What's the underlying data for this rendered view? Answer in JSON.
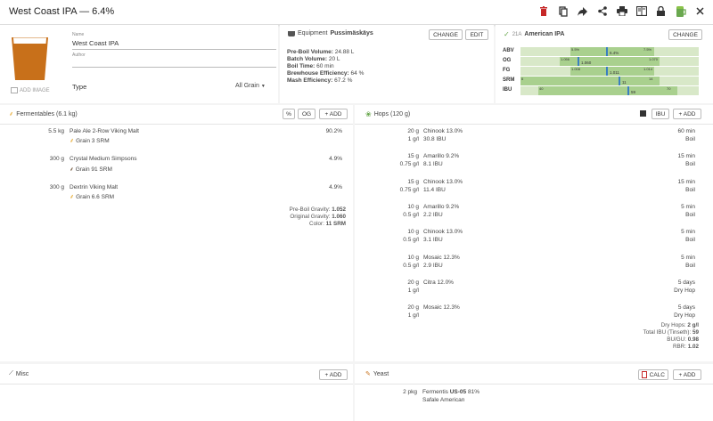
{
  "header": {
    "title": "West Coast IPA — 6.4%"
  },
  "toolbar_icons": [
    "delete-icon",
    "copy-icon",
    "share-arrow-icon",
    "share-icon",
    "print-icon",
    "book-icon",
    "lock-icon",
    "beer-icon",
    "close-icon"
  ],
  "recipe": {
    "add_image_label": "ADD IMAGE",
    "name_label": "Name",
    "name_value": "West Coast IPA",
    "author_label": "Author",
    "author_value": "",
    "type_label": "Type",
    "type_value": "All Grain"
  },
  "equipment": {
    "label": "Equipment",
    "name": "Pussimäskäys",
    "change_label": "CHANGE",
    "edit_label": "EDIT",
    "stats": [
      {
        "k": "Pre-Boil Volume:",
        "v": "24.88 L"
      },
      {
        "k": "Batch Volume:",
        "v": "20 L"
      },
      {
        "k": "Boil Time:",
        "v": "60 min"
      },
      {
        "k": "Brewhouse Efficiency:",
        "v": "64 %"
      },
      {
        "k": "Mash Efficiency:",
        "v": "67.2 %"
      }
    ]
  },
  "style": {
    "code": "21A",
    "name": "American IPA",
    "change_label": "CHANGE",
    "rows": [
      {
        "name": "ABV",
        "min": "5.5%",
        "max": "7.5%",
        "value": "6.4%",
        "range": [
          0.28,
          0.75
        ],
        "pos": 0.48
      },
      {
        "name": "OG",
        "min": "1.056",
        "max": "1.070",
        "value": "1.060",
        "range": [
          0.22,
          0.78
        ],
        "pos": 0.32
      },
      {
        "name": "FG",
        "min": "1.008",
        "max": "1.014",
        "value": "1.011",
        "range": [
          0.28,
          0.75
        ],
        "pos": 0.48
      },
      {
        "name": "SRM",
        "min": "6",
        "max": "14",
        "value": "11",
        "range": [
          0.0,
          0.78
        ],
        "pos": 0.55
      },
      {
        "name": "IBU",
        "min": "40",
        "max": "70",
        "value": "59",
        "range": [
          0.1,
          0.88
        ],
        "pos": 0.6
      }
    ]
  },
  "fermentables": {
    "title": "Fermentables (6.1 kg)",
    "btn_pct": "%",
    "btn_og": "OG",
    "btn_add": "+ ADD",
    "items": [
      {
        "amount": "5.5 kg",
        "name": "Pale Ale 2-Row Viking Malt",
        "sub": "Grain 3 SRM",
        "pct": "90.2%"
      },
      {
        "amount": "300 g",
        "name": "Crystal Medium Simpsons",
        "sub": "Grain 91 SRM",
        "pct": "4.9%"
      },
      {
        "amount": "300 g",
        "name": "Dextrin Viking Malt",
        "sub": "Grain 6.6 SRM",
        "pct": "4.9%"
      }
    ],
    "summary": [
      {
        "k": "Pre-Boil Gravity:",
        "v": "1.052"
      },
      {
        "k": "Original Gravity:",
        "v": "1.060"
      },
      {
        "k": "Color:",
        "v": "11 SRM"
      }
    ]
  },
  "hops": {
    "title": "Hops (120 g)",
    "btn_ibu": "IBU",
    "btn_add": "+ ADD",
    "items": [
      {
        "amount": "20 g",
        "gl": "1 g/l",
        "name": "Chinook 13.0%",
        "ibu": "30.8 IBU",
        "time": "60 min",
        "use": "Boil"
      },
      {
        "amount": "15 g",
        "gl": "0.75 g/l",
        "name": "Amarillo 9.2%",
        "ibu": "8.1 IBU",
        "time": "15 min",
        "use": "Boil"
      },
      {
        "amount": "15 g",
        "gl": "0.75 g/l",
        "name": "Chinook 13.0%",
        "ibu": "11.4 IBU",
        "time": "15 min",
        "use": "Boil"
      },
      {
        "amount": "10 g",
        "gl": "0.5 g/l",
        "name": "Amarillo 9.2%",
        "ibu": "2.2 IBU",
        "time": "5 min",
        "use": "Boil"
      },
      {
        "amount": "10 g",
        "gl": "0.5 g/l",
        "name": "Chinook 13.0%",
        "ibu": "3.1 IBU",
        "time": "5 min",
        "use": "Boil"
      },
      {
        "amount": "10 g",
        "gl": "0.5 g/l",
        "name": "Mosaic 12.3%",
        "ibu": "2.9 IBU",
        "time": "5 min",
        "use": "Boil"
      },
      {
        "amount": "20 g",
        "gl": "1 g/l",
        "name": "Citra 12.0%",
        "ibu": "",
        "time": "5 days",
        "use": "Dry Hop"
      },
      {
        "amount": "20 g",
        "gl": "1 g/l",
        "name": "Mosaic 12.3%",
        "ibu": "",
        "time": "5 days",
        "use": "Dry Hop"
      }
    ],
    "summary": [
      {
        "k": "Dry Hops:",
        "v": "2 g/l"
      },
      {
        "k": "Total IBU (Tinseth):",
        "v": "59"
      },
      {
        "k": "BU/GU:",
        "v": "0.98"
      },
      {
        "k": "RBR:",
        "v": "1.02"
      }
    ]
  },
  "misc": {
    "title": "Misc",
    "btn_add": "+ ADD"
  },
  "yeast": {
    "title": "Yeast",
    "btn_calc": "CALC",
    "btn_add": "+ ADD",
    "amount": "2 pkg",
    "brand": "Fermentis",
    "name": "US-05",
    "attenuation": "81%",
    "sub": "Safale American"
  }
}
